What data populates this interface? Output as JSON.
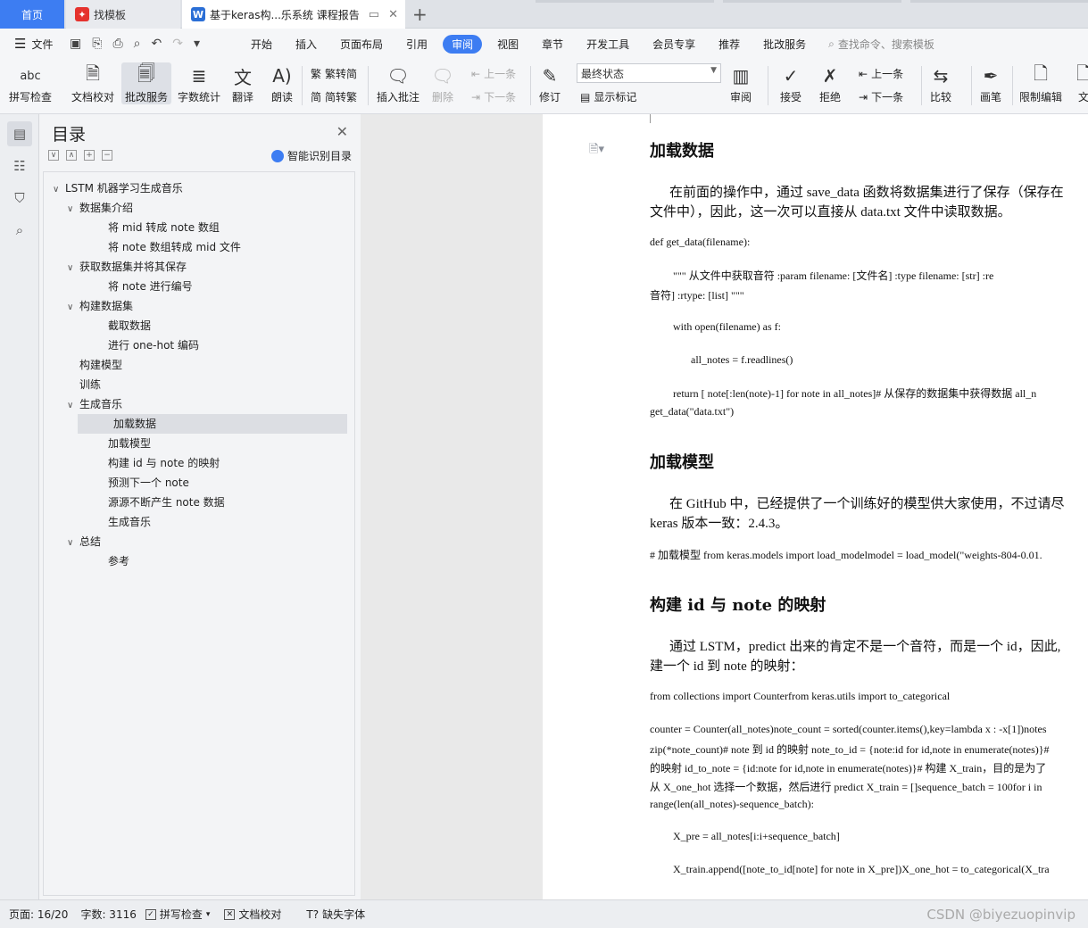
{
  "tabs": {
    "home": "首页",
    "template": "找模板",
    "document": "基于keras构...乐系统 课程报告"
  },
  "menu": {
    "file": "文件",
    "tabs": [
      "开始",
      "插入",
      "页面布局",
      "引用",
      "审阅",
      "视图",
      "章节",
      "开发工具",
      "会员专享",
      "推荐",
      "批改服务"
    ],
    "active_tab": "审阅",
    "search": "查找命令、搜索模板"
  },
  "ribbon": {
    "spell": "拼写检查",
    "doc_check": "文档校对",
    "review_service": "批改服务",
    "word_count": "字数统计",
    "translate": "翻译",
    "read": "朗读",
    "to_trad": "繁转简",
    "to_simp": "简转繁",
    "insert_comment": "插入批注",
    "delete": "删除",
    "prev": "上一条",
    "next": "下一条",
    "revise": "修订",
    "final_state": "最终状态",
    "show_marks": "显示标记",
    "review": "审阅",
    "accept": "接受",
    "reject": "拒绝",
    "prev2": "上一条",
    "next2": "下一条",
    "compare": "比较",
    "pen": "画笔",
    "restrict": "限制编辑",
    "doc_more": "文"
  },
  "toc": {
    "title": "目录",
    "smart": "智能识别目录",
    "items": [
      {
        "label": "LSTM  机器学习生成音乐",
        "level": 1,
        "expanded": true
      },
      {
        "label": "数据集介绍",
        "level": 2,
        "expanded": true
      },
      {
        "label": "将  mid  转成  note  数组",
        "level": 3
      },
      {
        "label": "将  note  数组转成  mid  文件",
        "level": 3
      },
      {
        "label": "获取数据集并将其保存",
        "level": 2,
        "expanded": true
      },
      {
        "label": "将  note  进行编号",
        "level": 3
      },
      {
        "label": "构建数据集",
        "level": 2,
        "expanded": true
      },
      {
        "label": "截取数据",
        "level": 3
      },
      {
        "label": "进行  one-hot  编码",
        "level": 3
      },
      {
        "label": "构建模型",
        "level": 2
      },
      {
        "label": "训练",
        "level": 2
      },
      {
        "label": "生成音乐",
        "level": 2,
        "expanded": true
      },
      {
        "label": "加载数据",
        "level": 3,
        "selected": true
      },
      {
        "label": "加载模型",
        "level": 3
      },
      {
        "label": "构建  id  与  note  的映射",
        "level": 3
      },
      {
        "label": "预测下一个  note",
        "level": 3
      },
      {
        "label": "源源不断产生  note  数据",
        "level": 3
      },
      {
        "label": "生成音乐",
        "level": 3
      },
      {
        "label": "总结",
        "level": 2,
        "expanded": true
      },
      {
        "label": "参考",
        "level": 3
      }
    ]
  },
  "document": {
    "h_load_data": "加载数据",
    "p1_l1": "在前面的操作中，通过 save_data 函数将数据集进行了保存（保存在",
    "p1_l2": "文件中），因此，这一次可以直接从 data.txt 文件中读取数据。",
    "c1": "def get_data(filename):",
    "c2": "\"\"\" 从文件中获取音符        :param filename: [文件名]        :type filename: [str]        :re",
    "c3": "音符]        :rtype: [list]        \"\"\"",
    "c4": "with open(filename) as f:",
    "c5": "all_notes = f.readlines()",
    "c6": "return [ note[:len(note)-1]     for note in all_notes]#  从保存的数据集中获得数据 all_n",
    "c7": "get_data(\"data.txt\")",
    "h_load_model": "加载模型",
    "p2_l1": "在 GitHub 中，已经提供了一个训练好的模型供大家使用，不过请尽",
    "p2_l2": "keras 版本一致：2.4.3。",
    "c8": "#  加载模型  from keras.models import load_modelmodel = load_model(\"weights-804-0.01.",
    "h_mapping": "构建  id  与  note  的映射",
    "p3_l1": "通过 LSTM，predict 出来的肯定不是一个音符，而是一个 id，因此,",
    "p3_l2": "建一个 id 到 note 的映射：",
    "c9": "from collections import Counterfrom keras.utils import to_categorical",
    "c10": "counter = Counter(all_notes)note_count = sorted(counter.items(),key=lambda x : -x[1])notes",
    "c11": "zip(*note_count)# note 到 id 的映射 note_to_id = {note:id for id,note in enumerate(notes)}#",
    "c12": "的映射 id_to_note = {id:note for id,note in enumerate(notes)}#  构建 X_train，目的是为了",
    "c13": "从 X_one_hot 选择一个数据，然后进行 predict X_train = []sequence_batch = 100for i in",
    "c14": "range(len(all_notes)-sequence_batch):",
    "c15": "X_pre = all_notes[i:i+sequence_batch]",
    "c16": "X_train.append([note_to_id[note] for note in X_pre])X_one_hot = to_categorical(X_tra"
  },
  "status": {
    "page": "页面: 16/20",
    "words": "字数: 3116",
    "spell": "拼写检查",
    "doc_check": "文档校对",
    "missing_font": "缺失字体",
    "watermark": "CSDN @biyezuopinvip"
  }
}
